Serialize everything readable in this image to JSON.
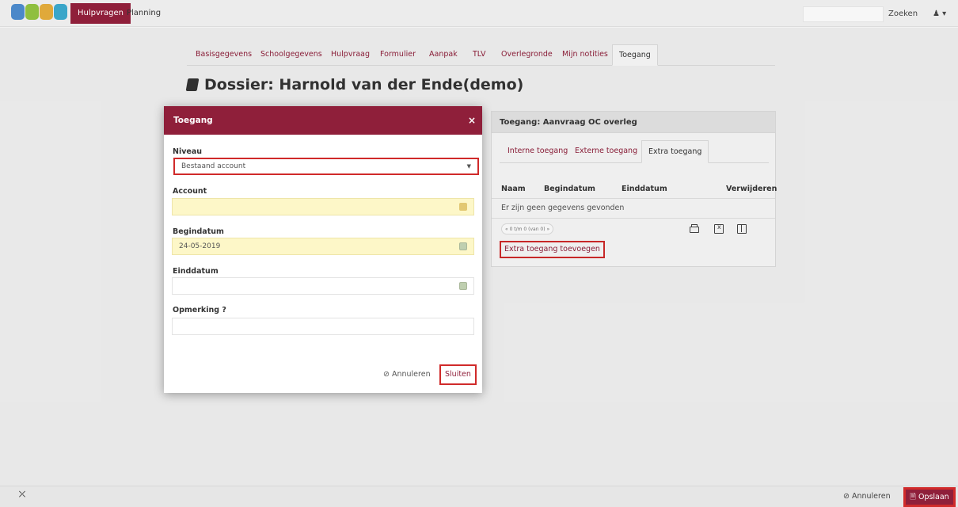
{
  "topbar": {
    "logo_colors": [
      "#4b88c9",
      "#8fbf3f",
      "#e0a93a",
      "#3aa6c9"
    ],
    "nav_active": "Hulpvragen",
    "nav_item": "Planning",
    "search_label": "Zoeken",
    "user_menu": "▾"
  },
  "tabs": [
    "Basisgegevens",
    "Schoolgegevens",
    "Hulpvraag",
    "Formulier",
    "Aanpak",
    "TLV",
    "Overlegronde",
    "Mijn notities",
    "Toegang"
  ],
  "active_tab": "Toegang",
  "dossier_title": "Dossier: Harnold van der Ende(demo)",
  "panel": {
    "title": "Toegang: Aanvraag OC overleg",
    "sub_tabs": [
      "Interne toegang",
      "Externe toegang",
      "Extra toegang"
    ],
    "active_sub_tab": "Extra toegang",
    "columns": [
      "Naam",
      "Begindatum",
      "Einddatum",
      "Verwijderen"
    ],
    "empty_message": "Er zijn geen gegevens gevonden",
    "pager": "« 0 t/m 0 (van 0) »",
    "add_button": "Extra toegang toevoegen"
  },
  "modal": {
    "title": "Toegang",
    "close": "×",
    "niveau_label": "Niveau",
    "niveau_value": "Bestaand account",
    "account_label": "Account",
    "account_value": "",
    "begindatum_label": "Begindatum",
    "begindatum_value": "24-05-2019",
    "einddatum_label": "Einddatum",
    "einddatum_value": "",
    "opmerking_label": "Opmerking ?",
    "opmerking_value": "",
    "cancel_label": "⊘ Annuleren",
    "close_button": "Sluiten"
  },
  "footer": {
    "cancel_label": "⊘ Annuleren",
    "save_label": "🗎 Opslaan"
  },
  "colors": {
    "brand": "#8f1f3a",
    "highlight": "#d02a2a",
    "field_yellow": "#fdf7c8"
  }
}
